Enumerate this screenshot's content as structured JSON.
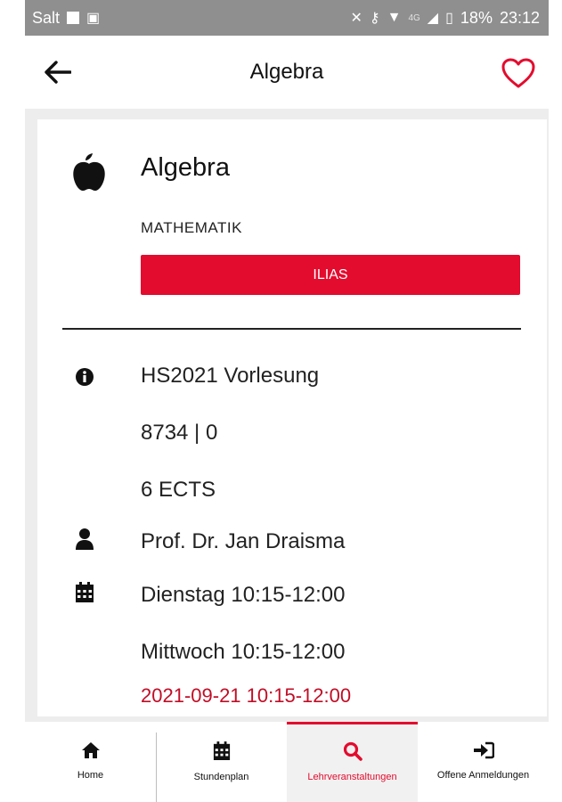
{
  "status_bar": {
    "carrier": "Salt",
    "network": "4G",
    "battery": "18%",
    "time": "23:12"
  },
  "header": {
    "title": "Algebra",
    "back_icon": "arrow-left-icon",
    "favorite_icon": "heart-outline-icon"
  },
  "course": {
    "name": "Algebra",
    "department": "MATHEMATIK",
    "ilias_label": "ILIAS",
    "semester_type": "HS2021 Vorlesung",
    "number": "8734 | 0",
    "ects": "6 ECTS",
    "lecturer": "Prof. Dr. Jan Draisma",
    "schedule": [
      "Dienstag 10:15-12:00",
      "Mittwoch 10:15-12:00"
    ],
    "next_date": "2021-09-21 10:15-12:00"
  },
  "bottom_nav": [
    {
      "label": "Home",
      "icon": "home-icon"
    },
    {
      "label": "Stundenplan",
      "icon": "calendar-icon"
    },
    {
      "label": "Lehrveranstaltungen",
      "icon": "search-icon"
    },
    {
      "label": "Offene Anmeldungen",
      "icon": "sign-in-icon"
    }
  ],
  "colors": {
    "accent": "#e30c2e",
    "date_red": "#c10d26",
    "background_gray": "#ededed"
  }
}
